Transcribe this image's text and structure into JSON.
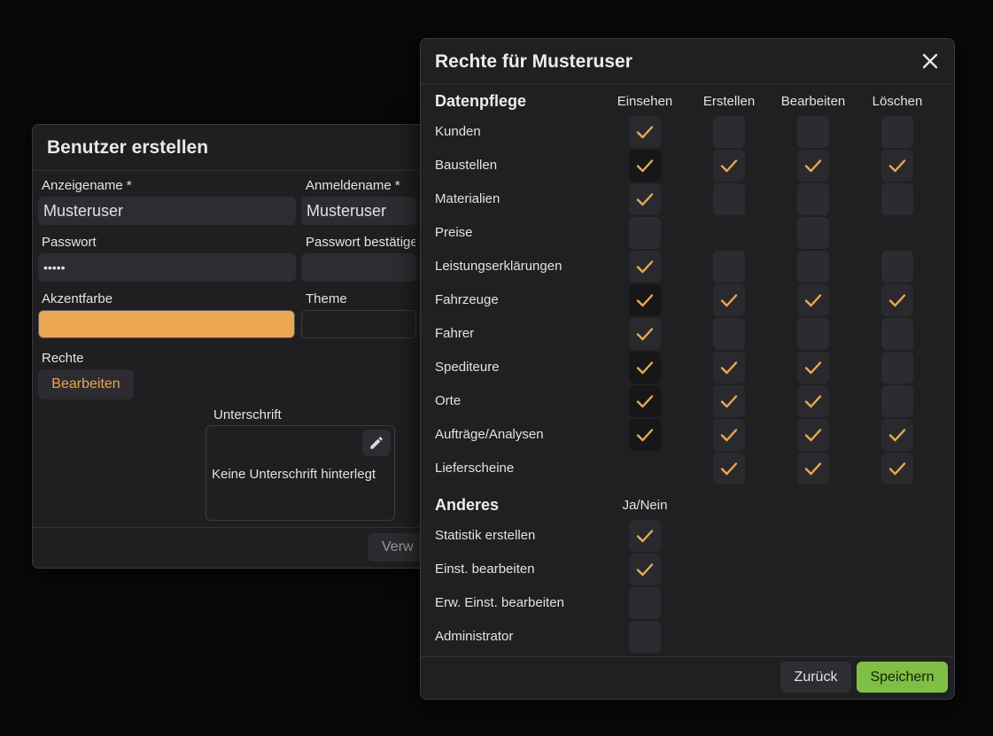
{
  "background_dialog": {
    "title": "Benutzer erstellen",
    "display_name_label": "Anzeigename *",
    "display_name_value": "Musteruser",
    "login_name_label": "Anmeldename *",
    "login_name_value": "Musteruser",
    "password_label": "Passwort",
    "password_value": "•••••",
    "password_confirm_label": "Passwort bestätigen",
    "accent_color_label": "Akzentfarbe",
    "accent_color": "#eca752",
    "theme_label": "Theme",
    "rights_label": "Rechte",
    "edit_button": "Bearbeiten",
    "signature_label": "Unterschrift",
    "signature_empty": "Keine Unterschrift hinterlegt",
    "footer_button_partial": "Verw"
  },
  "modal": {
    "title": "Rechte für Musteruser",
    "section1_title": "Datenpflege",
    "columns": [
      "Einsehen",
      "Erstellen",
      "Bearbeiten",
      "Löschen"
    ],
    "rows": [
      {
        "label": "Kunden",
        "cells": [
          true,
          false,
          false,
          false
        ]
      },
      {
        "label": "Baustellen",
        "cells": [
          true,
          true,
          true,
          true
        ]
      },
      {
        "label": "Materialien",
        "cells": [
          true,
          false,
          false,
          false
        ]
      },
      {
        "label": "Preise",
        "cells": [
          false,
          null,
          false,
          null
        ]
      },
      {
        "label": "Leistungserklärungen",
        "cells": [
          true,
          false,
          false,
          false
        ]
      },
      {
        "label": "Fahrzeuge",
        "cells": [
          true,
          true,
          true,
          true
        ]
      },
      {
        "label": "Fahrer",
        "cells": [
          true,
          false,
          false,
          false
        ]
      },
      {
        "label": "Spediteure",
        "cells": [
          true,
          true,
          true,
          false
        ]
      },
      {
        "label": "Orte",
        "cells": [
          true,
          true,
          true,
          false
        ]
      },
      {
        "label": "Aufträge/Analysen",
        "cells": [
          true,
          true,
          true,
          true
        ]
      },
      {
        "label": "Lieferscheine",
        "cells": [
          null,
          true,
          true,
          true
        ]
      }
    ],
    "section2_title": "Anderes",
    "section2_column": "Ja/Nein",
    "other_rows": [
      {
        "label": "Statistik erstellen",
        "checked": true
      },
      {
        "label": "Einst. bearbeiten",
        "checked": true
      },
      {
        "label": "Erw. Einst. bearbeiten",
        "checked": false
      },
      {
        "label": "Administrator",
        "checked": false
      }
    ],
    "back_button": "Zurück",
    "save_button": "Speichern"
  },
  "colors": {
    "accent": "#eca752",
    "save_green": "#7fbf45",
    "background": "#080808",
    "panel": "#202023"
  },
  "icons": {
    "close": "close-icon",
    "check": "check-icon",
    "pen": "pencil-icon"
  }
}
